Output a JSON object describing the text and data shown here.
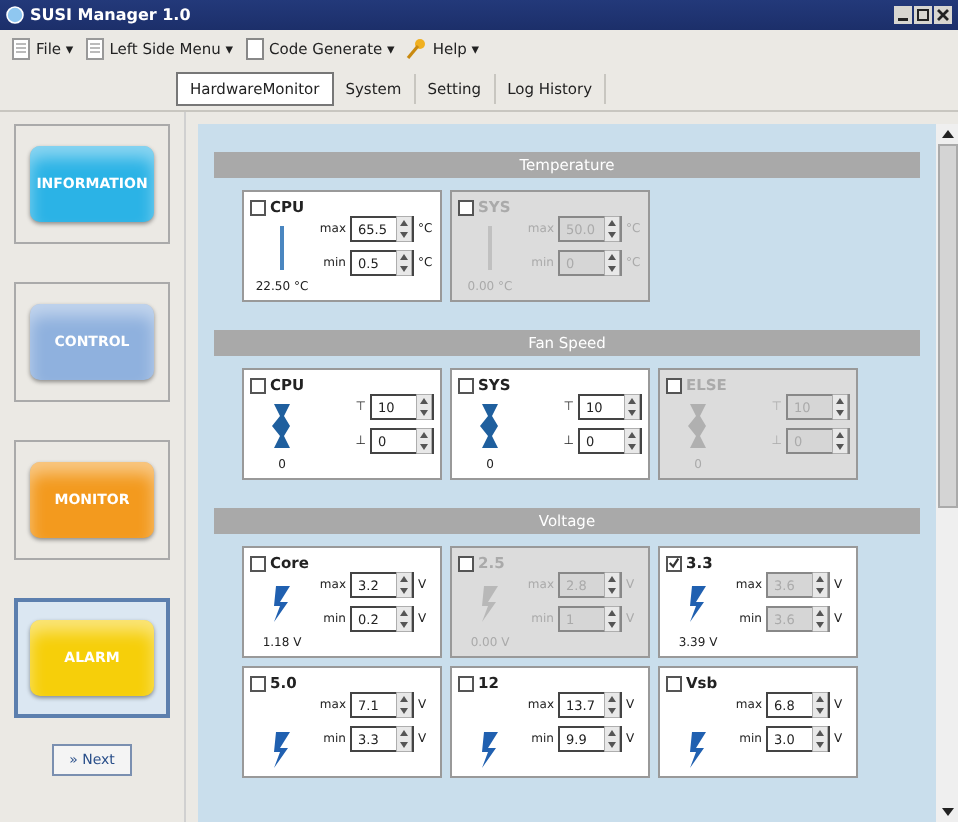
{
  "window": {
    "title": "SUSI Manager 1.0"
  },
  "menu": [
    {
      "label": "File ▾"
    },
    {
      "label": "Left Side Menu ▾"
    },
    {
      "label": "Code Generate ▾"
    },
    {
      "label": "Help ▾"
    }
  ],
  "tabs": [
    {
      "label": "HardwareMonitor",
      "selected": true
    },
    {
      "label": "System",
      "selected": false
    },
    {
      "label": "Setting",
      "selected": false
    },
    {
      "label": "Log History",
      "selected": false
    }
  ],
  "sidebar": {
    "items": [
      {
        "label": "INFORMATION",
        "color": "#2bb3e6",
        "selected": false
      },
      {
        "label": "CONTROL",
        "color": "#8fb1de",
        "selected": false
      },
      {
        "label": "MONITOR",
        "color": "#f39a1e",
        "selected": false
      },
      {
        "label": "ALARM",
        "color": "#f6cf0a",
        "selected": true
      }
    ],
    "next_button": "» Next"
  },
  "sections": [
    {
      "title": "Temperature",
      "kind": "temperature",
      "cards": [
        {
          "name": "CPU",
          "checked": false,
          "disabled": false,
          "reading": "22.50 °C",
          "fields": [
            {
              "label": "max",
              "value": "65.5",
              "unit": "°C",
              "disabled": false
            },
            {
              "label": "min",
              "value": "0.5",
              "unit": "°C",
              "disabled": false
            }
          ]
        },
        {
          "name": "SYS",
          "checked": false,
          "disabled": true,
          "reading": "0.00 °C",
          "fields": [
            {
              "label": "max",
              "value": "50.0",
              "unit": "°C",
              "disabled": true
            },
            {
              "label": "min",
              "value": "0",
              "unit": "°C",
              "disabled": true
            }
          ]
        }
      ]
    },
    {
      "title": "Fan Speed",
      "kind": "fan",
      "cards": [
        {
          "name": "CPU",
          "checked": false,
          "disabled": false,
          "reading": "0",
          "fields": [
            {
              "label": "⊤",
              "value": "10",
              "disabled": false
            },
            {
              "label": "⊥",
              "value": "0",
              "disabled": false
            }
          ]
        },
        {
          "name": "SYS",
          "checked": false,
          "disabled": false,
          "reading": "0",
          "fields": [
            {
              "label": "⊤",
              "value": "10",
              "disabled": false
            },
            {
              "label": "⊥",
              "value": "0",
              "disabled": false
            }
          ]
        },
        {
          "name": "ELSE",
          "checked": false,
          "disabled": true,
          "reading": "0",
          "fields": [
            {
              "label": "⊤",
              "value": "10",
              "disabled": true
            },
            {
              "label": "⊥",
              "value": "0",
              "disabled": true
            }
          ]
        }
      ]
    },
    {
      "title": "Voltage",
      "kind": "voltage",
      "cards": [
        {
          "name": "Core",
          "checked": false,
          "disabled": false,
          "reading": "1.18 V",
          "fields": [
            {
              "label": "max",
              "value": "3.2",
              "unit": "V",
              "disabled": false
            },
            {
              "label": "min",
              "value": "0.2",
              "unit": "V",
              "disabled": false
            }
          ]
        },
        {
          "name": "2.5",
          "checked": false,
          "disabled": true,
          "reading": "0.00 V",
          "fields": [
            {
              "label": "max",
              "value": "2.8",
              "unit": "V",
              "disabled": true
            },
            {
              "label": "min",
              "value": "1",
              "unit": "V",
              "disabled": true
            }
          ]
        },
        {
          "name": "3.3",
          "checked": true,
          "disabled": false,
          "reading": "3.39 V",
          "fields": [
            {
              "label": "max",
              "value": "3.6",
              "unit": "V",
              "disabled": true
            },
            {
              "label": "min",
              "value": "3.6",
              "unit": "V",
              "disabled": true
            }
          ]
        },
        {
          "name": "5.0",
          "checked": false,
          "disabled": false,
          "fields": [
            {
              "label": "max",
              "value": "7.1",
              "unit": "V",
              "disabled": false
            },
            {
              "label": "min",
              "value": "3.3",
              "unit": "V",
              "disabled": false
            }
          ]
        },
        {
          "name": "12",
          "checked": false,
          "disabled": false,
          "fields": [
            {
              "label": "max",
              "value": "13.7",
              "unit": "V",
              "disabled": false
            },
            {
              "label": "min",
              "value": "9.9",
              "unit": "V",
              "disabled": false
            }
          ]
        },
        {
          "name": "Vsb",
          "checked": false,
          "disabled": false,
          "fields": [
            {
              "label": "max",
              "value": "6.8",
              "unit": "V",
              "disabled": false
            },
            {
              "label": "min",
              "value": "3.0",
              "unit": "V",
              "disabled": false
            }
          ]
        }
      ]
    }
  ]
}
